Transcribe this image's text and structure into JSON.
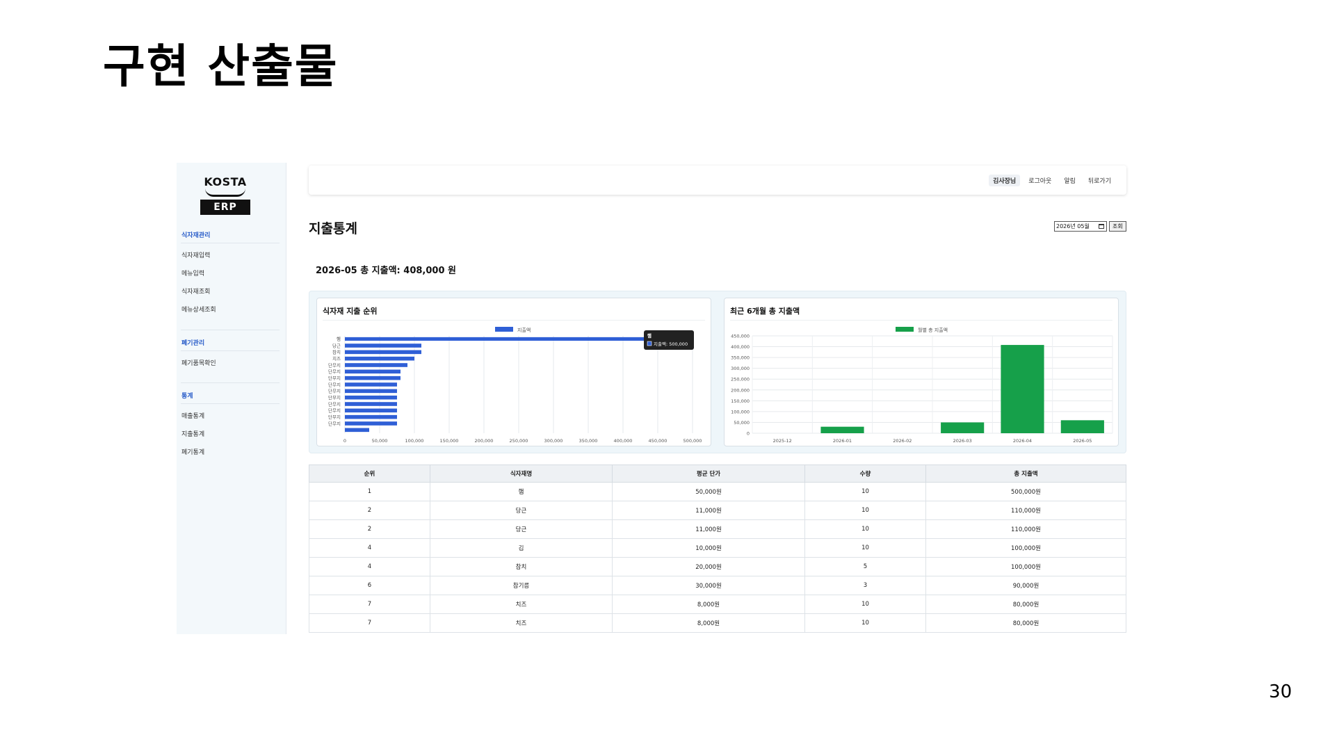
{
  "slide": {
    "title": "구현 산출물",
    "page_number": "30"
  },
  "sidebar": {
    "logo_top": "KOSTA",
    "logo_bottom": "ERP",
    "sections": [
      {
        "head": "식자재관리",
        "items": [
          "식자재입력",
          "메뉴입력",
          "식자재조회",
          "메뉴상세조회"
        ]
      },
      {
        "head": "폐기관리",
        "items": [
          "폐기품목확인"
        ]
      },
      {
        "head": "통계",
        "items": [
          "매출통계",
          "지출통계",
          "폐기통계"
        ]
      }
    ]
  },
  "header": {
    "user": "김사장님",
    "logout": "로그아웃",
    "alarm": "알림",
    "back": "뒤로가기"
  },
  "page": {
    "title": "지출통계",
    "month_value": "2026년 05월",
    "query_label": "조회",
    "total_text": "2026-05 총 지출액: 408,000 원"
  },
  "colors": {
    "bar_blue": "#2f5fd6",
    "bar_green": "#16a04a",
    "tooltip_bg": "#222222"
  },
  "chart_data": [
    {
      "type": "bar",
      "orientation": "horizontal",
      "title": "식자재 지출 순위",
      "legend": "지출액",
      "legend_position": "top",
      "categories": [
        "햄",
        "당근",
        "참치",
        "치즈",
        "단무지",
        "단무지",
        "단무지",
        "단무지",
        "단무지",
        "단무지",
        "단무지",
        "단무지",
        "단무지",
        "단무지"
      ],
      "values": [
        500000,
        110000,
        110000,
        100000,
        90000,
        80000,
        80000,
        75000,
        75000,
        75000,
        75000,
        75000,
        75000,
        75000
      ],
      "extra_bar": 35000,
      "xlim": [
        0,
        500000
      ],
      "xticks": [
        "0",
        "50,000",
        "100,000",
        "150,000",
        "200,000",
        "250,000",
        "300,000",
        "350,000",
        "400,000",
        "450,000",
        "500,000"
      ],
      "tooltip": {
        "title": "햄",
        "text": "지출액: 500,000"
      },
      "grid": true
    },
    {
      "type": "bar",
      "title": "최근 6개월 총 지출액",
      "legend": "월별 총 지출액",
      "legend_position": "top",
      "categories": [
        "2025-12",
        "2026-01",
        "2026-02",
        "2026-03",
        "2026-04",
        "2026-05"
      ],
      "values": [
        0,
        30000,
        0,
        50000,
        408000,
        60000
      ],
      "ylim": [
        0,
        450000
      ],
      "yticks": [
        "0",
        "50,000",
        "100,000",
        "150,000",
        "200,000",
        "250,000",
        "300,000",
        "350,000",
        "400,000",
        "450,000"
      ],
      "grid": true
    }
  ],
  "table": {
    "headers": [
      "순위",
      "식자재명",
      "평균 단가",
      "수량",
      "총 지출액"
    ],
    "rows": [
      [
        "1",
        "햄",
        "50,000원",
        "10",
        "500,000원"
      ],
      [
        "2",
        "당근",
        "11,000원",
        "10",
        "110,000원"
      ],
      [
        "2",
        "당근",
        "11,000원",
        "10",
        "110,000원"
      ],
      [
        "4",
        "김",
        "10,000원",
        "10",
        "100,000원"
      ],
      [
        "4",
        "참치",
        "20,000원",
        "5",
        "100,000원"
      ],
      [
        "6",
        "참기름",
        "30,000원",
        "3",
        "90,000원"
      ],
      [
        "7",
        "치즈",
        "8,000원",
        "10",
        "80,000원"
      ],
      [
        "7",
        "치즈",
        "8,000원",
        "10",
        "80,000원"
      ]
    ]
  }
}
